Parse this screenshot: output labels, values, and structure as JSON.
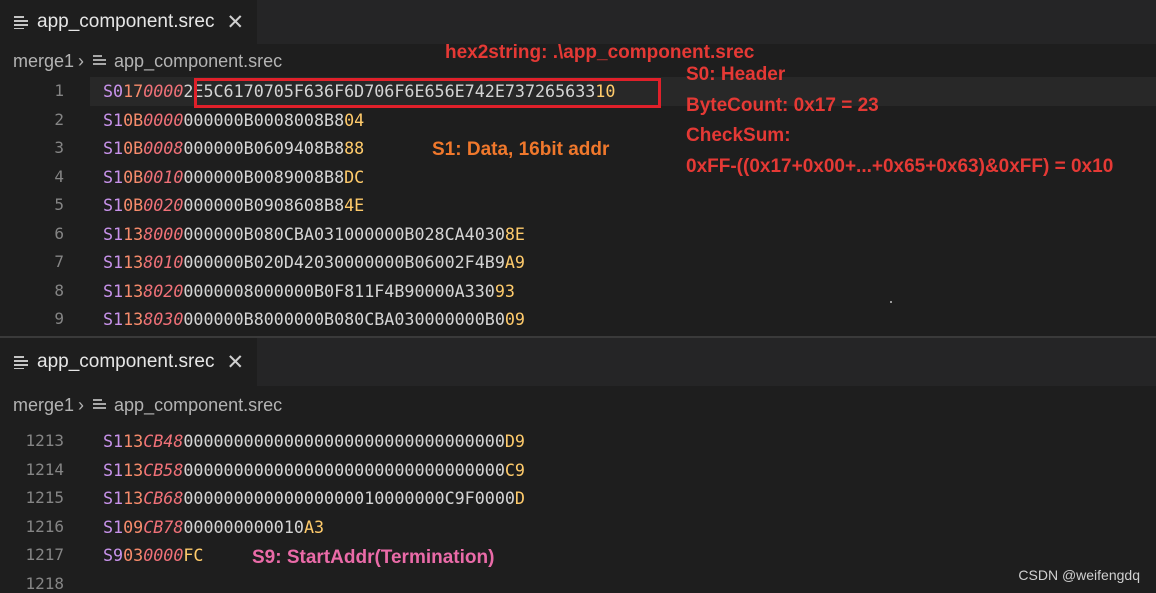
{
  "top_pane": {
    "tab": {
      "label": "app_component.srec",
      "icon": "file-lines-icon",
      "close": "✕"
    },
    "breadcrumb": {
      "folder": "merge1",
      "separator": "›",
      "file": "app_component.srec"
    },
    "lines": [
      {
        "ln": "1",
        "type": "S0",
        "count": "17",
        "addr": "0000",
        "data": "2E5C6170705F636F6D706F6E656E742E737265633",
        "chk": "10"
      },
      {
        "ln": "2",
        "type": "S1",
        "count": "0B",
        "addr": "0000",
        "data": "000000B0008008B8",
        "chk": "04"
      },
      {
        "ln": "3",
        "type": "S1",
        "count": "0B",
        "addr": "0008",
        "data": "000000B0609408B8",
        "chk": "88"
      },
      {
        "ln": "4",
        "type": "S1",
        "count": "0B",
        "addr": "0010",
        "data": "000000B0089008B8",
        "chk": "DC"
      },
      {
        "ln": "5",
        "type": "S1",
        "count": "0B",
        "addr": "0020",
        "data": "000000B0908608B8",
        "chk": "4E"
      },
      {
        "ln": "6",
        "type": "S1",
        "count": "13",
        "addr": "8000",
        "data": "000000B080CBA031000000B028CA4030",
        "chk": "8E"
      },
      {
        "ln": "7",
        "type": "S1",
        "count": "13",
        "addr": "8010",
        "data": "000000B020D42030000000B06002F4B9",
        "chk": "A9"
      },
      {
        "ln": "8",
        "type": "S1",
        "count": "13",
        "addr": "8020",
        "data": "0000008000000B0F811F4B90000A330",
        "chk": "93"
      },
      {
        "ln": "9",
        "type": "S1",
        "count": "13",
        "addr": "8030",
        "data": "000000B8000000B080CBA030000000B0",
        "chk": "09"
      }
    ],
    "annotations": {
      "hex2string": "hex2string: .\\app_component.srec",
      "s0_header": "S0: Header",
      "bytecount": "ByteCount: 0x17 = 23",
      "checksum": "CheckSum:",
      "checksum_formula": "0xFF-((0x17+0x00+...+0x65+0x63)&0xFF) = 0x10",
      "s1_data": "S1: Data, 16bit addr"
    }
  },
  "bottom_pane": {
    "tab": {
      "label": "app_component.srec",
      "icon": "file-lines-icon",
      "close": "✕"
    },
    "breadcrumb": {
      "folder": "merge1",
      "separator": "›",
      "file": "app_component.srec"
    },
    "lines": [
      {
        "ln": "1213",
        "type": "S1",
        "count": "13",
        "addr": "CB48",
        "data": "00000000000000000000000000000000",
        "chk": "D9"
      },
      {
        "ln": "1214",
        "type": "S1",
        "count": "13",
        "addr": "CB58",
        "data": "00000000000000000000000000000000",
        "chk": "C9"
      },
      {
        "ln": "1215",
        "type": "S1",
        "count": "13",
        "addr": "CB68",
        "data": "00000000000000000010000000C9F0000",
        "chk": "D"
      },
      {
        "ln": "1216",
        "type": "S1",
        "count": "09",
        "addr": "CB78",
        "data": "000000000010",
        "chk": "A3"
      },
      {
        "ln": "1217",
        "type": "S9",
        "count": "03",
        "addr": "0000",
        "data": "",
        "chk": "FC"
      },
      {
        "ln": "1218",
        "type": "",
        "count": "",
        "addr": "",
        "data": "",
        "chk": ""
      }
    ],
    "annotations": {
      "s9_start": "S9: StartAddr(Termination)"
    }
  },
  "watermark": "CSDN @weifengdq",
  "colors": {
    "background": "#1e1e1e",
    "record_type": "#c792ea",
    "byte_count": "#f78c6c",
    "address": "#f07178",
    "data": "#d4d4d4",
    "checksum": "#ffcb6b",
    "annotation_red": "#e53935",
    "annotation_orange": "#f0782c",
    "annotation_pink": "#ea6ba8"
  }
}
